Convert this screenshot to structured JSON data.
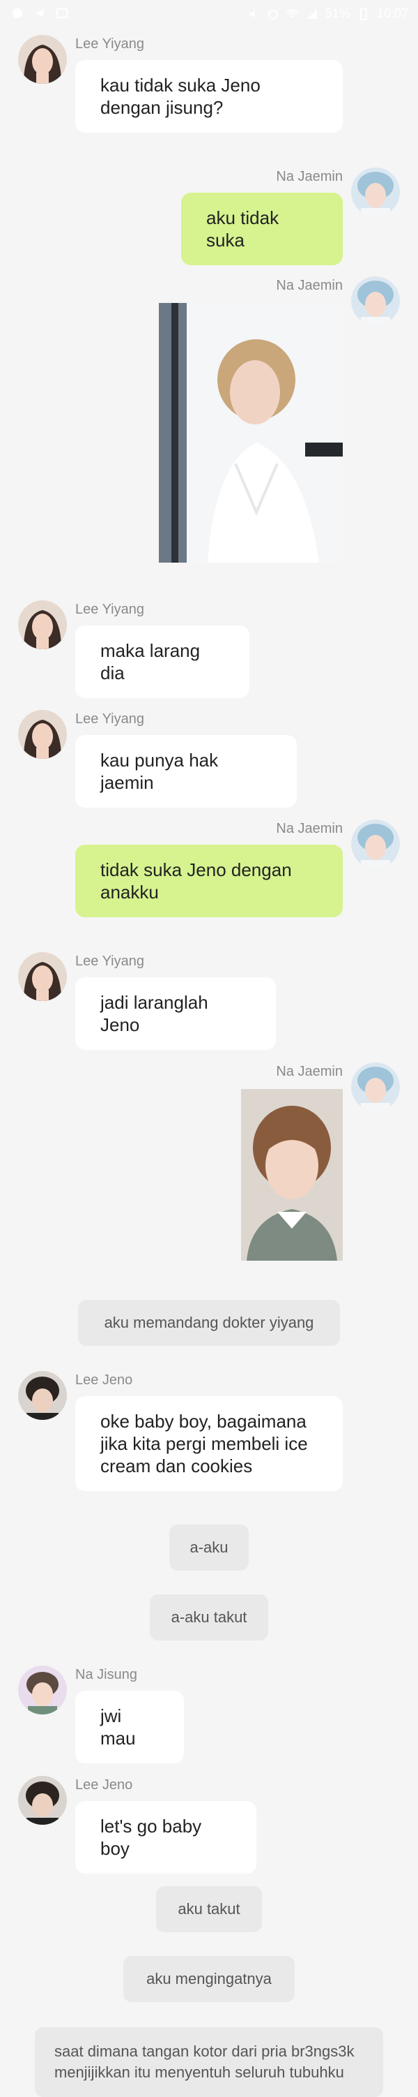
{
  "status_bar": {
    "time": "10:07",
    "battery": "51%",
    "icons": [
      "notification-icon",
      "telegram-icon",
      "gallery-icon",
      "mute-icon",
      "alarm-icon",
      "wifi-icon",
      "signal-icon",
      "battery-icon"
    ]
  },
  "messages": [
    {
      "sender": "Lee Yiyang",
      "side": "left",
      "text": "kau tidak suka Jeno dengan jisung?"
    },
    {
      "sender": "Na Jaemin",
      "side": "right",
      "text": "aku tidak suka"
    },
    {
      "sender": "Na Jaemin",
      "side": "right",
      "image": "photo-blond-boy"
    },
    {
      "sender": "Lee Yiyang",
      "side": "left",
      "text": "maka larang dia"
    },
    {
      "sender": "Lee Yiyang",
      "side": "left",
      "text": "kau punya hak jaemin"
    },
    {
      "sender": "Na Jaemin",
      "side": "right",
      "text": "tidak suka Jeno dengan anakku"
    },
    {
      "sender": "Lee Yiyang",
      "side": "left",
      "text": "jadi laranglah Jeno"
    },
    {
      "sender": "Na Jaemin",
      "side": "right",
      "image": "photo-brown-hair-boy"
    },
    {
      "narration": "aku memandang dokter yiyang"
    },
    {
      "sender": "Lee Jeno",
      "side": "left",
      "text": "oke baby boy, bagaimana jika kita pergi membeli ice cream dan cookies"
    },
    {
      "narration": "a-aku"
    },
    {
      "narration": "a-aku takut"
    },
    {
      "sender": "Na Jisung",
      "side": "left",
      "text": "jwi mau"
    },
    {
      "sender": "Lee Jeno",
      "side": "left",
      "text": "let's go baby boy"
    },
    {
      "narration": "aku takut"
    },
    {
      "narration": "aku mengingatnya"
    },
    {
      "narration": "saat dimana tangan kotor dari pria br3ngs3k menjijikkan itu menyentuh seluruh tubuhku"
    }
  ],
  "colors": {
    "background": "#f5f5f5",
    "bubble_left": "#ffffff",
    "bubble_right": "#d6f38f",
    "narration": "#e9e9e9"
  }
}
